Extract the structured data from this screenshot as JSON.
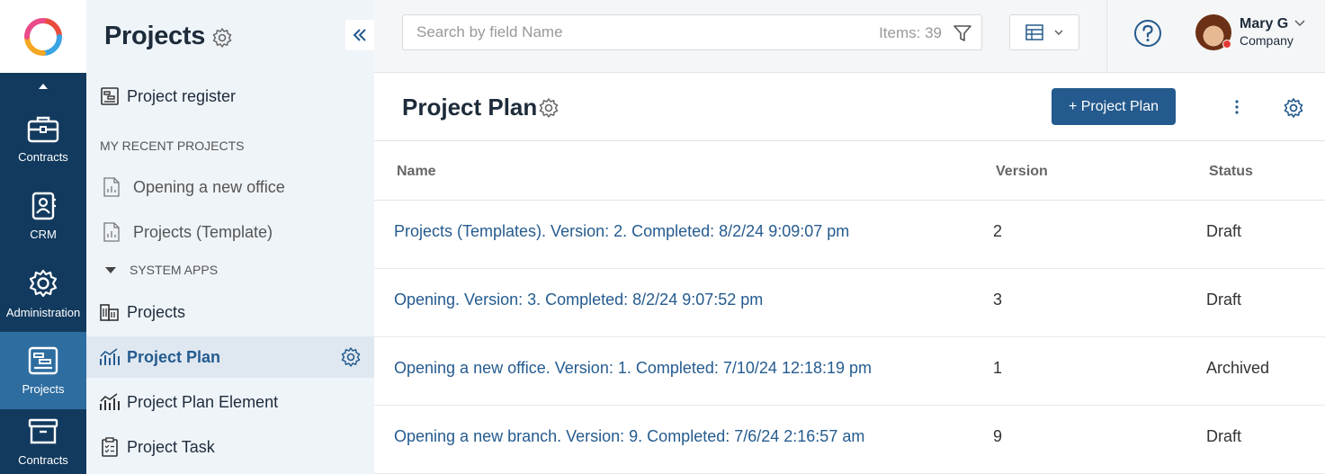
{
  "rail": {
    "items": [
      {
        "label": "Contracts"
      },
      {
        "label": "CRM"
      },
      {
        "label": "Administration"
      },
      {
        "label": "Projects"
      },
      {
        "label": "Contracts"
      }
    ]
  },
  "sidebar": {
    "title": "Projects",
    "register_label": "Project register",
    "recent_section": "MY RECENT PROJECTS",
    "recent": [
      {
        "label": "Opening a new office"
      },
      {
        "label": "Projects (Template)"
      }
    ],
    "system_section": "SYSTEM APPS",
    "system_apps": [
      {
        "label": "Projects"
      },
      {
        "label": "Project Plan"
      },
      {
        "label": "Project Plan Element"
      },
      {
        "label": "Project Task"
      }
    ]
  },
  "search": {
    "placeholder": "Search by field Name",
    "count": "Items: 39"
  },
  "user": {
    "name": "Mary G",
    "company": "Company"
  },
  "page": {
    "title": "Project Plan",
    "add_button": "+ Project Plan"
  },
  "table": {
    "headers": {
      "name": "Name",
      "version": "Version",
      "status": "Status"
    },
    "rows": [
      {
        "name": "Projects (Templates). Version: 2. Completed: 8/2/24 9:09:07 pm",
        "version": "2",
        "status": "Draft"
      },
      {
        "name": "Opening. Version: 3. Completed: 8/2/24 9:07:52 pm",
        "version": "3",
        "status": "Draft"
      },
      {
        "name": "Opening a new office. Version: 1. Completed: 7/10/24 12:18:19 pm",
        "version": "1",
        "status": "Archived"
      },
      {
        "name": "Opening a new branch. Version: 9. Completed: 7/6/24 2:16:57 am",
        "version": "9",
        "status": "Draft"
      }
    ]
  },
  "colors": {
    "rail": "#123a5e",
    "rail_active": "#2e6da0",
    "accent": "#245a8d",
    "link": "#255b8f",
    "sidebar_bg": "#eff4f9"
  }
}
